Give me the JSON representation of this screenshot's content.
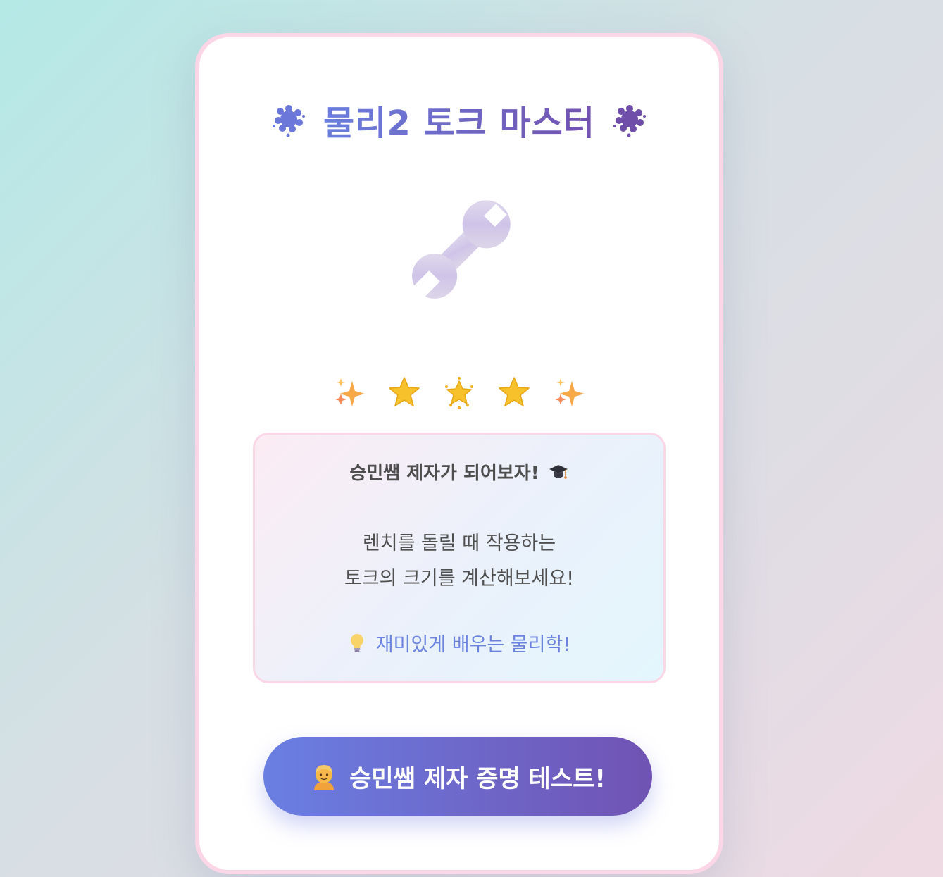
{
  "title": {
    "text": "물리2 토크 마스터",
    "left_icon": "burst-icon",
    "right_icon": "burst-icon"
  },
  "hero_icon": "wrench-icon",
  "stars_row": [
    "sparkles-icon",
    "star-icon",
    "glowing-star-icon",
    "star-icon",
    "sparkles-icon"
  ],
  "info": {
    "headline": "승민쌤 제자가 되어보자!",
    "headline_icon": "graduation-cap-icon",
    "line1": "렌치를 돌릴 때 작용하는",
    "line2": "토크의 크기를 계산해보세요!",
    "tip": "재미있게 배우는 물리학!",
    "tip_icon": "lightbulb-icon"
  },
  "cta": {
    "label": "승민쌤 제자 증명 테스트!",
    "icon": "person-icon"
  },
  "colors": {
    "accent_start": "#6a7fe3",
    "accent_end": "#7053b3",
    "card_border": "#fbd6e6",
    "tip_text": "#6b83de"
  }
}
